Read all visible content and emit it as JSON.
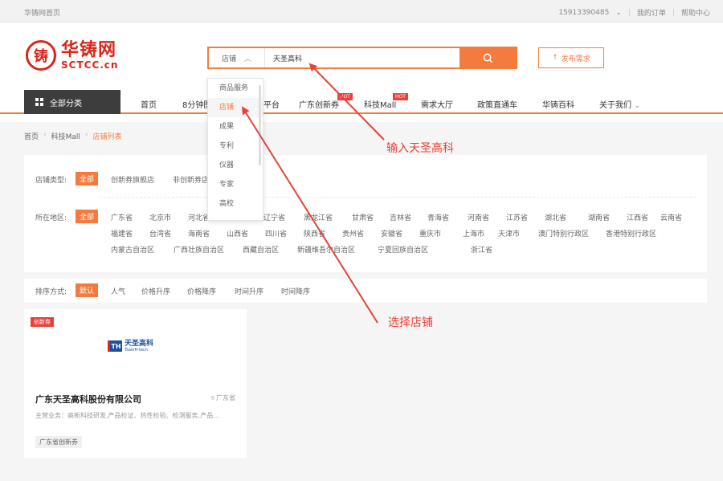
{
  "topbar": {
    "home": "华铸网首页",
    "phone": "15913390485",
    "orders": "我的订单",
    "help": "帮助中心"
  },
  "logo": {
    "mark": "铸",
    "cn": "华铸网",
    "en": "SCTCC.cn"
  },
  "search": {
    "type_label": "店铺",
    "value": "天圣高科",
    "publish_label": "发布需求",
    "accent": "#f47b3e"
  },
  "dropdown": {
    "items": [
      "商品服务",
      "店铺",
      "成果",
      "专利",
      "仪器",
      "专家",
      "高校"
    ],
    "active_index": 1
  },
  "nav": {
    "all_categories": "全部分类",
    "items": [
      "首页",
      "8分钟图",
      "平台",
      "广东创新券",
      "科技Mall",
      "需求大厅",
      "政策直通车",
      "华铸百科",
      "关于我们"
    ],
    "hot_label": "HOT"
  },
  "breadcrumb": {
    "home": "首页",
    "mall": "科技Mall",
    "current": "店铺列表"
  },
  "filter": {
    "shop_type_label": "店铺类型:",
    "all_label": "全部",
    "shop_types": [
      "创新券旗舰店",
      "非创新券店"
    ],
    "region_label": "所在地区:",
    "regions_row1": [
      "广东省",
      "北京市",
      "河北省",
      "辽宁省",
      "黑龙江省",
      "甘肃省",
      "吉林省",
      "青海省",
      "河南省",
      "江苏省",
      "湖北省",
      "湖南省",
      "江西省",
      "云南省"
    ],
    "regions_row2": [
      "福建省",
      "台湾省",
      "海南省",
      "山西省",
      "四川省",
      "陕西省",
      "贵州省",
      "安徽省",
      "重庆市",
      "上海市",
      "天津市",
      "澳门特别行政区",
      "香港特别行政区"
    ],
    "regions_row3": [
      "内蒙古自治区",
      "广西壮族自治区",
      "西藏自治区",
      "新疆维吾尔自治区",
      "宁夏回族自治区",
      "浙江省"
    ]
  },
  "sort": {
    "label": "排序方式:",
    "default": "默认",
    "options": [
      "人气",
      "价格升序",
      "价格降序",
      "时间升序",
      "时间降序"
    ]
  },
  "shop": {
    "badge": "创新券",
    "logo_mark": "TH",
    "logo_cn": "天圣高科",
    "logo_en": "TsainH-tech",
    "name": "广东天圣高科股份有限公司",
    "location": "广东省",
    "business": "主营业务：高新科技研发,产品检证、热性检验、检测服务,产品...",
    "tag": "广东省创新券"
  },
  "annotations": {
    "input_hint": "输入天圣高科",
    "select_hint": "选择店铺",
    "color": "#e8423a"
  }
}
